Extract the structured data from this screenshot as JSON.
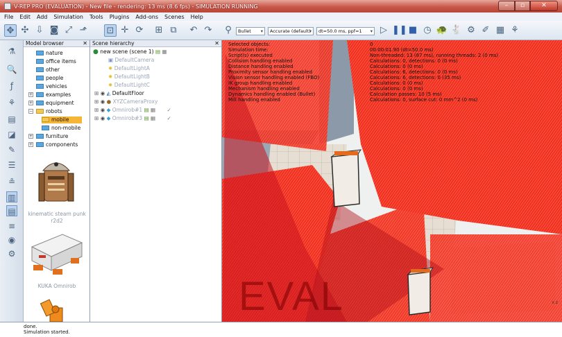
{
  "window": {
    "title": "V-REP PRO (EVALUATION) - New file - rendering: 13 ms (8.6 fps) - SIMULATION RUNNING"
  },
  "menu": [
    "File",
    "Edit",
    "Add",
    "Simulation",
    "Tools",
    "Plugins",
    "Add-ons",
    "Scenes",
    "Help"
  ],
  "toolbar": {
    "engine": "Bullet",
    "accuracy": "Accurate (default)",
    "timestep": "dt=50.0 ms, ppf=1"
  },
  "model_browser": {
    "title": "Model browser",
    "folders": [
      "nature",
      "office items",
      "other",
      "people",
      "vehicles",
      "examples",
      "equipment",
      "robots",
      "mobile",
      "non-mobile",
      "furniture",
      "components"
    ],
    "thumbnails": [
      "kinematic steam punk r2d2",
      "KUKA Omnirob"
    ]
  },
  "scene_hierarchy": {
    "title": "Scene hierarchy",
    "root": "new scene (scene 1)",
    "items": [
      "DefaultCamera",
      "DefaultLightA",
      "DefaultLightB",
      "DefaultLightC",
      "DefaultFloor",
      "XYZCameraProxy",
      "Omnirob#1",
      "Omnirob#3"
    ]
  },
  "info": [
    {
      "k": "Selected objects:",
      "v": "0"
    },
    {
      "k": "Simulation time:",
      "v": "00:00:01.90 (dt=50.0 ms)"
    },
    {
      "k": "Script(s) executed",
      "v": "Non-threaded: 13 (87 ms), running threads: 2 (0 ms)"
    },
    {
      "k": "Collision handling enabled",
      "v": "Calculations: 0, detections: 0 (0 ms)"
    },
    {
      "k": "Distance handling enabled",
      "v": "Calculations: 0 (0 ms)"
    },
    {
      "k": "Proximity sensor handling enabled",
      "v": "Calculations: 6, detections: 0 (0 ms)"
    },
    {
      "k": "Vision sensor handling enabled (FBO)",
      "v": "Calculations: 6, detections: 0 (35 ms)"
    },
    {
      "k": "IK group handling enabled",
      "v": "Calculations: 0 (0 ms)"
    },
    {
      "k": "Mechanism handling enabled",
      "v": "Calculations: 0 (0 ms)"
    },
    {
      "k": "Dynamics handling enabled (Bullet)",
      "v": "Calculation passes: 10 (5 ms)"
    },
    {
      "k": "Mill handling enabled",
      "v": "Calculations: 0, surface cut: 0 mm^2 (0 ms)"
    }
  ],
  "watermark": "EVAL",
  "axes": [
    "x",
    "z"
  ],
  "status": [
    "done.",
    "Simulation started."
  ]
}
